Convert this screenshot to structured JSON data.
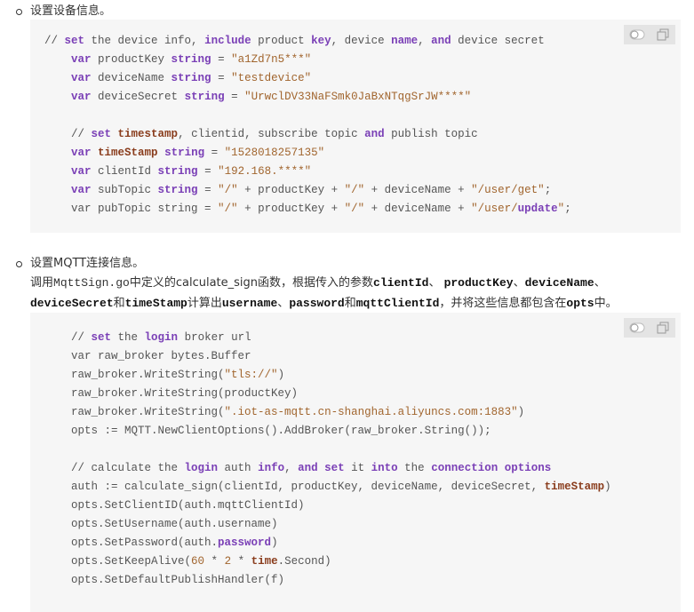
{
  "section1": {
    "title": "设置设备信息。",
    "code": [
      [
        {
          "t": "// "
        },
        {
          "t": "set",
          "c": "kw"
        },
        {
          "t": " the device info, "
        },
        {
          "t": "include",
          "c": "kw"
        },
        {
          "t": " product "
        },
        {
          "t": "key",
          "c": "kw"
        },
        {
          "t": ", device "
        },
        {
          "t": "name",
          "c": "kw"
        },
        {
          "t": ", "
        },
        {
          "t": "and",
          "c": "kw"
        },
        {
          "t": " device secret"
        }
      ],
      [
        {
          "t": "    "
        },
        {
          "t": "var",
          "c": "kw"
        },
        {
          "t": " productKey "
        },
        {
          "t": "string",
          "c": "ty"
        },
        {
          "t": " = "
        },
        {
          "t": "\"a1Zd7n5***\"",
          "c": "str"
        }
      ],
      [
        {
          "t": "    "
        },
        {
          "t": "var",
          "c": "kw"
        },
        {
          "t": " deviceName "
        },
        {
          "t": "string",
          "c": "ty"
        },
        {
          "t": " = "
        },
        {
          "t": "\"testdevice\"",
          "c": "str"
        }
      ],
      [
        {
          "t": "    "
        },
        {
          "t": "var",
          "c": "kw"
        },
        {
          "t": " deviceSecret "
        },
        {
          "t": "string",
          "c": "ty"
        },
        {
          "t": " = "
        },
        {
          "t": "\"UrwclDV33NaFSmk0JaBxNTqgSrJW****\"",
          "c": "str"
        }
      ],
      [
        {
          "t": ""
        }
      ],
      [
        {
          "t": "    // "
        },
        {
          "t": "set",
          "c": "kw"
        },
        {
          "t": " "
        },
        {
          "t": "timestamp",
          "c": "hl"
        },
        {
          "t": ", clientid, subscribe topic "
        },
        {
          "t": "and",
          "c": "kw"
        },
        {
          "t": " publish topic"
        }
      ],
      [
        {
          "t": "    "
        },
        {
          "t": "var",
          "c": "kw"
        },
        {
          "t": " "
        },
        {
          "t": "timeStamp",
          "c": "hl"
        },
        {
          "t": " "
        },
        {
          "t": "string",
          "c": "ty"
        },
        {
          "t": " = "
        },
        {
          "t": "\"1528018257135\"",
          "c": "str"
        }
      ],
      [
        {
          "t": "    "
        },
        {
          "t": "var",
          "c": "kw"
        },
        {
          "t": " clientId "
        },
        {
          "t": "string",
          "c": "ty"
        },
        {
          "t": " = "
        },
        {
          "t": "\"192.168.****\"",
          "c": "str"
        }
      ],
      [
        {
          "t": "    "
        },
        {
          "t": "var",
          "c": "kw"
        },
        {
          "t": " subTopic "
        },
        {
          "t": "string",
          "c": "ty"
        },
        {
          "t": " = "
        },
        {
          "t": "\"/\"",
          "c": "str"
        },
        {
          "t": " + productKey + "
        },
        {
          "t": "\"/\"",
          "c": "str"
        },
        {
          "t": " + deviceName + "
        },
        {
          "t": "\"/user/get\"",
          "c": "str"
        },
        {
          "t": ";"
        }
      ],
      [
        {
          "t": "    var pubTopic string = "
        },
        {
          "t": "\"/\"",
          "c": "str"
        },
        {
          "t": " + productKey + "
        },
        {
          "t": "\"/\"",
          "c": "str"
        },
        {
          "t": " + deviceName + "
        },
        {
          "t": "\"/user/",
          "c": "str"
        },
        {
          "t": "update",
          "c": "kw"
        },
        {
          "t": "\"",
          "c": "str"
        },
        {
          "t": ";"
        }
      ]
    ]
  },
  "section2": {
    "title": "设置MQTT连接信息。",
    "desc_line1": [
      {
        "t": "调用"
      },
      {
        "t": "MqttSign.go",
        "c": "mono"
      },
      {
        "t": "中定义的calculate_sign函数，根据传入的参数"
      },
      {
        "t": "clientId",
        "c": "b"
      },
      {
        "t": "、 "
      },
      {
        "t": "productKey",
        "c": "b"
      },
      {
        "t": "、"
      },
      {
        "t": "deviceName",
        "c": "b"
      },
      {
        "t": "、"
      }
    ],
    "desc_line2": [
      {
        "t": "deviceSecret",
        "c": "b"
      },
      {
        "t": "和"
      },
      {
        "t": "timeStamp",
        "c": "b"
      },
      {
        "t": "计算出"
      },
      {
        "t": "username",
        "c": "b"
      },
      {
        "t": "、"
      },
      {
        "t": "password",
        "c": "b"
      },
      {
        "t": "和"
      },
      {
        "t": "mqttClientId",
        "c": "b"
      },
      {
        "t": "，并将这些信息都包含在"
      },
      {
        "t": "opts",
        "c": "b"
      },
      {
        "t": "中。"
      }
    ],
    "code": [
      [
        {
          "t": "    // "
        },
        {
          "t": "set",
          "c": "kw"
        },
        {
          "t": " the "
        },
        {
          "t": "login",
          "c": "kw"
        },
        {
          "t": " broker url"
        }
      ],
      [
        {
          "t": "    var raw_broker bytes.Buffer"
        }
      ],
      [
        {
          "t": "    raw_broker.WriteString("
        },
        {
          "t": "\"tls://\"",
          "c": "str"
        },
        {
          "t": ")"
        }
      ],
      [
        {
          "t": "    raw_broker.WriteString(productKey)"
        }
      ],
      [
        {
          "t": "    raw_broker.WriteString("
        },
        {
          "t": "\".iot-as-mqtt.cn-shanghai.aliyuncs.com:1883\"",
          "c": "str"
        },
        {
          "t": ")"
        }
      ],
      [
        {
          "t": "    opts := MQTT.NewClientOptions().AddBroker(raw_broker.String());"
        }
      ],
      [
        {
          "t": ""
        }
      ],
      [
        {
          "t": "    // calculate the "
        },
        {
          "t": "login",
          "c": "kw"
        },
        {
          "t": " auth "
        },
        {
          "t": "info",
          "c": "kw"
        },
        {
          "t": ", "
        },
        {
          "t": "and",
          "c": "kw"
        },
        {
          "t": " "
        },
        {
          "t": "set",
          "c": "kw"
        },
        {
          "t": " it "
        },
        {
          "t": "into",
          "c": "kw"
        },
        {
          "t": " the "
        },
        {
          "t": "connection",
          "c": "kw"
        },
        {
          "t": " "
        },
        {
          "t": "options",
          "c": "kw"
        }
      ],
      [
        {
          "t": "    auth := calculate_sign(clientId, productKey, deviceName, deviceSecret, "
        },
        {
          "t": "timeStamp",
          "c": "hl"
        },
        {
          "t": ")"
        }
      ],
      [
        {
          "t": "    opts.SetClientID(auth.mqttClientId)"
        }
      ],
      [
        {
          "t": "    opts.SetUsername(auth.username)"
        }
      ],
      [
        {
          "t": "    opts.SetPassword(auth."
        },
        {
          "t": "password",
          "c": "kw"
        },
        {
          "t": ")"
        }
      ],
      [
        {
          "t": "    opts.SetKeepAlive("
        },
        {
          "t": "60",
          "c": "num"
        },
        {
          "t": " * "
        },
        {
          "t": "2",
          "c": "num"
        },
        {
          "t": " * "
        },
        {
          "t": "time",
          "c": "hl"
        },
        {
          "t": ".Second)"
        }
      ],
      [
        {
          "t": "    opts.SetDefaultPublishHandler(f)"
        }
      ]
    ]
  },
  "icons": {
    "toggle": "toggle-icon",
    "copy": "copy-icon"
  },
  "colors": {
    "code_bg": "#f6f6f6",
    "keyword": "#7a3fb6",
    "string": "#a1652e",
    "toolbar_bg": "#e4e4e4"
  }
}
